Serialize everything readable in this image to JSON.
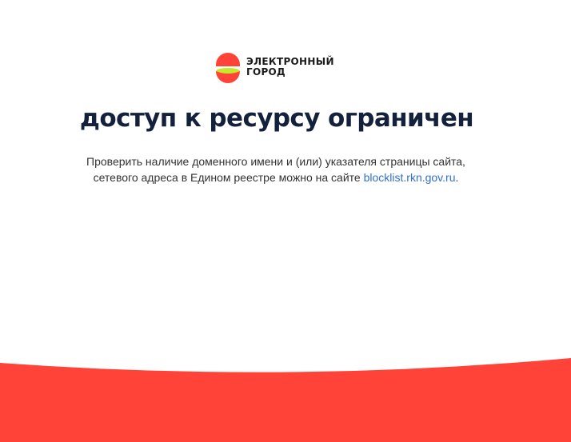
{
  "logo": {
    "line1": "ЭЛЕКТРОННЫЙ",
    "line2": "ГОРОД",
    "icon": "electronic-city-logo-icon",
    "colors": {
      "red": "#ff4339",
      "green": "#c5e82c"
    }
  },
  "headline": "доступ к ресурсу ограничен",
  "description": {
    "line1": "Проверить наличие доменного имени и (или) указателя страницы сайта,",
    "line2_prefix": "сетевого адреса в Едином реестре можно на сайте ",
    "link_text": "blocklist.rkn.gov.ru",
    "line2_suffix": "."
  },
  "colors": {
    "accent": "#ff4339",
    "headline": "#14213d",
    "link": "#2f6fd6"
  }
}
